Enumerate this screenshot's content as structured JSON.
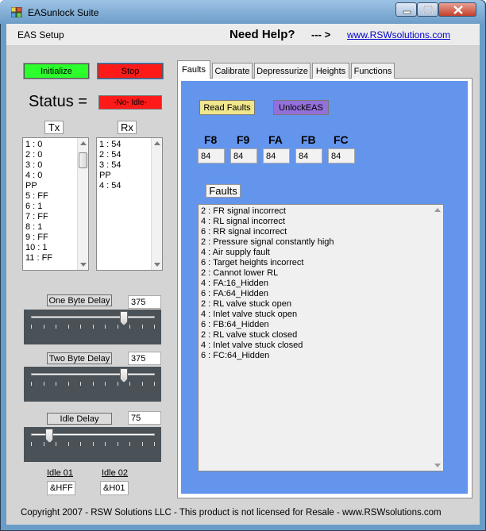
{
  "window": {
    "title": "EASunlock Suite"
  },
  "menu": {
    "setup_label": "EAS Setup"
  },
  "help": {
    "need_help": "Need Help?",
    "arrow": "--- >",
    "link": "www.RSWsolutions.com"
  },
  "controls": {
    "initialize_label": "Initialize",
    "stop_label": "Stop"
  },
  "status": {
    "label": "Status =",
    "value": "-No- Idle-"
  },
  "tx": {
    "label": "Tx",
    "lines": [
      "1 : 0",
      "2 : 0",
      "3 : 0",
      "4 : 0",
      "PP",
      "5 : FF",
      "6 : 1",
      "7 : FF",
      "8 : 1",
      "9 : FF",
      "10 : 1",
      "11 : FF"
    ]
  },
  "rx": {
    "label": "Rx",
    "lines": [
      "1 : 54",
      "2 : 54",
      "3 : 54",
      "PP",
      "4 : 54"
    ]
  },
  "delays": {
    "one_byte": {
      "label": "One Byte Delay",
      "value": "375",
      "level": 0.75
    },
    "two_byte": {
      "label": "Two Byte Delay",
      "value": "375",
      "level": 0.75
    },
    "idle": {
      "label": "Idle Delay",
      "value": "75",
      "level": 0.15
    }
  },
  "idle": {
    "idle01": {
      "label": "Idle 01",
      "value": "&HFF"
    },
    "idle02": {
      "label": "Idle 02",
      "value": "&H01"
    }
  },
  "tabs": [
    "Faults",
    "Calibrate",
    "Depressurize",
    "Heights",
    "Functions"
  ],
  "active_tab": "Faults",
  "faults_tab": {
    "read_faults_label": "Read Faults",
    "unlock_label": "UnlockEAS",
    "registers": [
      {
        "label": "F8",
        "value": "84"
      },
      {
        "label": "F9",
        "value": "84"
      },
      {
        "label": "FA",
        "value": "84"
      },
      {
        "label": "FB",
        "value": "84"
      },
      {
        "label": "FC",
        "value": "84"
      }
    ],
    "faults_label": "Faults",
    "faults": [
      "2 : FR signal incorrect",
      "4 : RL signal incorrect",
      "6 : RR signal incorrect",
      "2 : Pressure signal constantly high",
      "4 : Air supply fault",
      "6 : Target heights incorrect",
      "2 : Cannot lower RL",
      "4 : FA:16_Hidden",
      "6 : FA:64_Hidden",
      "2 : RL valve stuck open",
      "4 : Inlet valve stuck open",
      "6 : FB:64_Hidden",
      "2 : RL valve stuck closed",
      "4 : Inlet valve stuck closed",
      "6 : FC:64_Hidden"
    ]
  },
  "footer": "Copyright 2007 - RSW Solutions LLC - This product is not licensed for Resale - www.RSWsolutions.com",
  "colors": {
    "initialize": "#2cff2c",
    "stop": "#ff1a1a",
    "status": "#ff1a1a",
    "read_faults": "#f0e68c",
    "unlock": "#9370db",
    "panel_blue": "#6495ed"
  }
}
